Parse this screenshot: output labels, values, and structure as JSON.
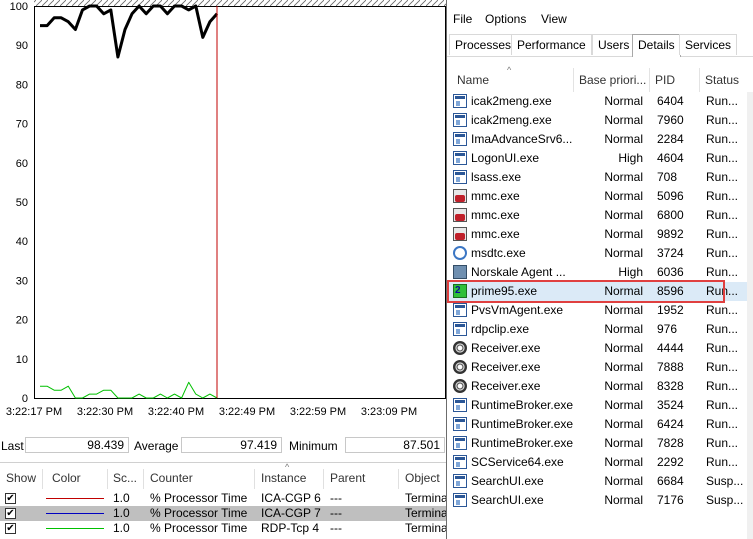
{
  "perfmon": {
    "chart_data": {
      "type": "line",
      "yaxis_ticks": [
        "100",
        "90",
        "80",
        "70",
        "60",
        "50",
        "40",
        "30",
        "20",
        "10",
        "0"
      ],
      "ylim": [
        0,
        100
      ],
      "xaxis_ticks": [
        "3:22:17 PM",
        "3:22:30 PM",
        "3:22:40 PM",
        "3:22:49 PM",
        "3:22:59 PM",
        "3:23:09 PM"
      ],
      "series": [
        {
          "color": "#000000",
          "values": [
            95,
            95,
            97,
            97,
            96,
            94,
            99,
            100,
            100,
            98,
            99,
            87,
            94,
            98,
            100,
            98,
            100,
            100,
            98,
            100,
            100,
            99,
            100,
            92,
            96,
            98
          ]
        },
        {
          "color": "#00c000",
          "values": [
            3,
            3,
            2,
            2,
            3,
            0,
            0,
            1,
            1,
            2,
            2,
            0,
            0,
            0,
            1,
            0,
            0,
            1,
            0,
            1,
            0,
            4,
            1,
            0,
            1,
            0
          ]
        }
      ],
      "cursor_color": "#c00000"
    },
    "stats": {
      "last_label": "Last",
      "last_value": "98.439",
      "average_label": "Average",
      "average_value": "97.419",
      "minimum_label": "Minimum",
      "minimum_value": "87.501"
    },
    "counter_table": {
      "headers": [
        "Show",
        "Color",
        "Sc...",
        "Counter",
        "Instance",
        "Parent",
        "Object"
      ],
      "rows": [
        {
          "check": "✔",
          "color": "#c00000",
          "scale": "1.0",
          "counter": "% Processor Time",
          "instance": "ICA-CGP 6",
          "parent": "---",
          "object": "Terminal"
        },
        {
          "check": "✔",
          "color": "#0000c0",
          "scale": "1.0",
          "counter": "% Processor Time",
          "instance": "ICA-CGP 7",
          "parent": "---",
          "object": "Terminal"
        },
        {
          "check": "✔",
          "color": "#00c000",
          "scale": "1.0",
          "counter": "% Processor Time",
          "instance": "RDP-Tcp 4",
          "parent": "---",
          "object": "Terminal"
        }
      ]
    }
  },
  "taskmgr": {
    "menu": [
      "File",
      "Options",
      "View"
    ],
    "tabs": [
      "Processes",
      "Performance",
      "Users",
      "Details",
      "Services"
    ],
    "active_tab": "Details",
    "columns": [
      "Name",
      "Base priori...",
      "PID",
      "Status"
    ],
    "processes": [
      {
        "icon": "app",
        "name": "icak2meng.exe",
        "priority": "Normal",
        "pid": "6404",
        "status": "Run..."
      },
      {
        "icon": "app",
        "name": "icak2meng.exe",
        "priority": "Normal",
        "pid": "7960",
        "status": "Run..."
      },
      {
        "icon": "app",
        "name": "ImaAdvanceSrv6...",
        "priority": "Normal",
        "pid": "2284",
        "status": "Run..."
      },
      {
        "icon": "app",
        "name": "LogonUI.exe",
        "priority": "High",
        "pid": "4604",
        "status": "Run..."
      },
      {
        "icon": "app",
        "name": "lsass.exe",
        "priority": "Normal",
        "pid": "708",
        "status": "Run..."
      },
      {
        "icon": "mmc",
        "name": "mmc.exe",
        "priority": "Normal",
        "pid": "5096",
        "status": "Run..."
      },
      {
        "icon": "mmc",
        "name": "mmc.exe",
        "priority": "Normal",
        "pid": "6800",
        "status": "Run..."
      },
      {
        "icon": "mmc",
        "name": "mmc.exe",
        "priority": "Normal",
        "pid": "9892",
        "status": "Run..."
      },
      {
        "icon": "msdtc",
        "name": "msdtc.exe",
        "priority": "Normal",
        "pid": "3724",
        "status": "Run..."
      },
      {
        "icon": "norskale",
        "name": "Norskale Agent ...",
        "priority": "High",
        "pid": "6036",
        "status": "Run..."
      },
      {
        "icon": "prime",
        "name": "prime95.exe",
        "priority": "Normal",
        "pid": "8596",
        "status": "Run...",
        "highlight": true
      },
      {
        "icon": "app",
        "name": "PvsVmAgent.exe",
        "priority": "Normal",
        "pid": "1952",
        "status": "Run..."
      },
      {
        "icon": "app",
        "name": "rdpclip.exe",
        "priority": "Normal",
        "pid": "976",
        "status": "Run..."
      },
      {
        "icon": "receiver",
        "name": "Receiver.exe",
        "priority": "Normal",
        "pid": "4444",
        "status": "Run..."
      },
      {
        "icon": "receiver",
        "name": "Receiver.exe",
        "priority": "Normal",
        "pid": "7888",
        "status": "Run..."
      },
      {
        "icon": "receiver",
        "name": "Receiver.exe",
        "priority": "Normal",
        "pid": "8328",
        "status": "Run..."
      },
      {
        "icon": "app",
        "name": "RuntimeBroker.exe",
        "priority": "Normal",
        "pid": "3524",
        "status": "Run..."
      },
      {
        "icon": "app",
        "name": "RuntimeBroker.exe",
        "priority": "Normal",
        "pid": "6424",
        "status": "Run..."
      },
      {
        "icon": "app",
        "name": "RuntimeBroker.exe",
        "priority": "Normal",
        "pid": "7828",
        "status": "Run..."
      },
      {
        "icon": "app",
        "name": "SCService64.exe",
        "priority": "Normal",
        "pid": "2292",
        "status": "Run..."
      },
      {
        "icon": "app",
        "name": "SearchUI.exe",
        "priority": "Normal",
        "pid": "6684",
        "status": "Susp..."
      },
      {
        "icon": "app",
        "name": "SearchUI.exe",
        "priority": "Normal",
        "pid": "7176",
        "status": "Susp..."
      }
    ]
  }
}
